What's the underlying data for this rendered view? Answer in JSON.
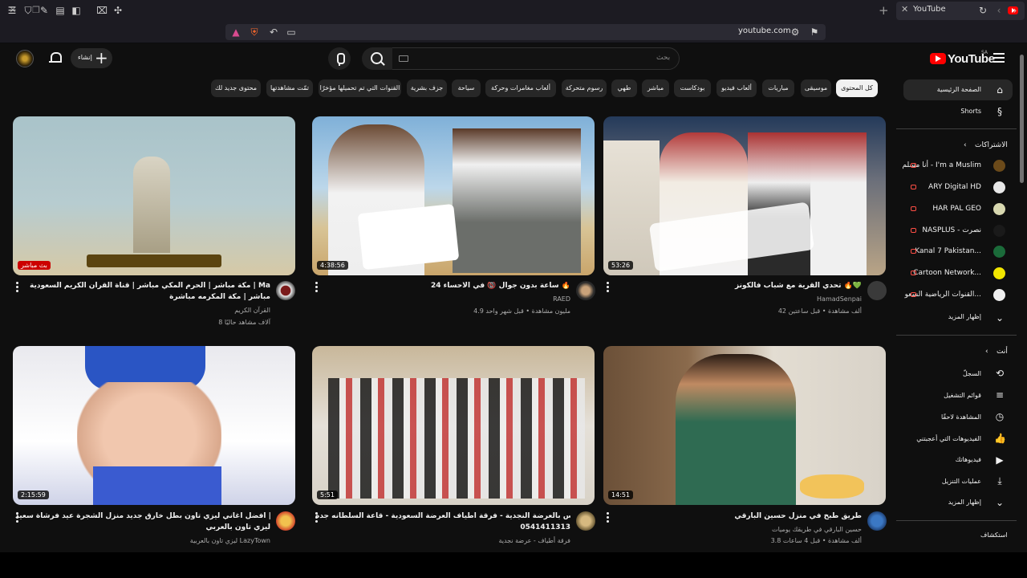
{
  "browser": {
    "tab_title": "YouTube",
    "url": "youtube.com"
  },
  "masthead": {
    "logo_text": "YouTube",
    "logo_region": "SA",
    "search_placeholder": "بحث",
    "create_label": "إنشاء"
  },
  "chips": [
    "كل المحتوى",
    "موسيقى",
    "مباريات",
    "ألعاب فيديو",
    "بودكاست",
    "مباشر",
    "طهي",
    "رسوم متحركة",
    "ألعاب مغامرات وحركة",
    "سياحة",
    "جزف بشرية",
    "القنوات التي تم تحميلها مؤخرًا",
    "تمّت مشاهدتها",
    "محتوى جديد لك"
  ],
  "sidebar": {
    "main": [
      {
        "label": "الصفحة الرئيسية",
        "icon": "home-icon"
      },
      {
        "label": "Shorts",
        "icon": "shorts-icon"
      }
    ],
    "subscriptions_header": "الاشتراكات",
    "subscriptions": [
      {
        "label": "أنا مسلم - I'm a Muslim",
        "color": "#6b4a1a"
      },
      {
        "label": "ARY Digital HD",
        "color": "#e8e8e8"
      },
      {
        "label": "HAR PAL GEO",
        "color": "#d8d8b0"
      },
      {
        "label": "NASPLUS - نصرت",
        "color": "#1a1a1a"
      },
      {
        "label": "Kanal 7 Pakistan...",
        "color": "#1b6b3a"
      },
      {
        "label": "Cartoon Network...",
        "color": "#f2e600"
      },
      {
        "label": "القنوات الرياضية السعو...",
        "color": "#f0f0f0"
      }
    ],
    "show_more": "إظهار المزيد",
    "you_header": "أنت",
    "you_items": [
      {
        "label": "السجلّ",
        "icon": "history-icon"
      },
      {
        "label": "قوائم التشغيل",
        "icon": "playlists-icon"
      },
      {
        "label": "المشاهدة لاحقًا",
        "icon": "watch-later-icon"
      },
      {
        "label": "الفيديوهات التي أعجبتني",
        "icon": "like-icon"
      },
      {
        "label": "فيديوهاتك",
        "icon": "your-videos-icon"
      },
      {
        "label": "عمليات التنزيل",
        "icon": "download-icon"
      }
    ],
    "show_more_2": "إظهار المزيد",
    "explore_header": "استكشاف"
  },
  "videos": [
    {
      "duration": "",
      "live_badge": "بث مباشر",
      "title_line1": "مكة مباشر | الحرم المكي مباشر | قناة القرآن الكريم السعودية | Makkah Live 🕋",
      "title_line2": "مباشر | مكة المكرمه مباشرة",
      "channel": "القرآن الكريم",
      "stats": "8 آلاف مشاهد حاليًا"
    },
    {
      "duration": "4:38:56",
      "title_line1": "24 ساعة بدون جوال 📵 في الاحساء 🔥",
      "title_line2": "",
      "channel": "RAED",
      "stats": "4.9 مليون مشاهدة • قبل شهر واحد"
    },
    {
      "duration": "53:26",
      "title_line1": "تحدي القرية مع شباب فالكونز 🔥💚",
      "title_line2": "",
      "channel": "HamadSenpai",
      "stats": "42 ألف مشاهدة • قبل ساعتين"
    },
    {
      "duration": "2:15:59",
      "title_line1": "ليزي تاون | أفضل أغاني ليزي تاون بطل خارق جديد منزل الشجرة عيد فرشاة سعيد |",
      "title_line2": "ليزي تاون بالعربي",
      "channel": "ليزي تاون بالعربية LazyTown",
      "stats": ""
    },
    {
      "duration": "5:51",
      "title_line1": "استقبال عريس بالعرضة النجدية - فرقة أطياف العرضة السعودية - قاعة السلطانه جدة",
      "title_line2": "0541411313",
      "channel": "فرقة أطياف - عرضة نجدية",
      "stats": ""
    },
    {
      "duration": "14:51",
      "title_line1": "طريق طبخ في منزل حسين البارقي",
      "title_line2": "",
      "channel": "حسين البارقي في طريقك يوميات",
      "stats": "3.8 ألف مشاهدة • قبل 4 ساعات"
    }
  ]
}
